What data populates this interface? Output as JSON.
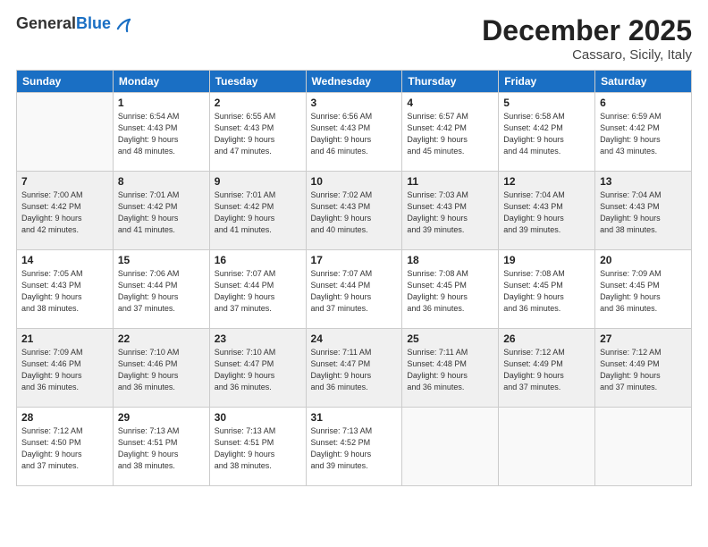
{
  "logo": {
    "general": "General",
    "blue": "Blue"
  },
  "header": {
    "month_title": "December 2025",
    "location": "Cassaro, Sicily, Italy"
  },
  "days_of_week": [
    "Sunday",
    "Monday",
    "Tuesday",
    "Wednesday",
    "Thursday",
    "Friday",
    "Saturday"
  ],
  "weeks": [
    [
      {
        "day": "",
        "info": ""
      },
      {
        "day": "1",
        "info": "Sunrise: 6:54 AM\nSunset: 4:43 PM\nDaylight: 9 hours\nand 48 minutes."
      },
      {
        "day": "2",
        "info": "Sunrise: 6:55 AM\nSunset: 4:43 PM\nDaylight: 9 hours\nand 47 minutes."
      },
      {
        "day": "3",
        "info": "Sunrise: 6:56 AM\nSunset: 4:43 PM\nDaylight: 9 hours\nand 46 minutes."
      },
      {
        "day": "4",
        "info": "Sunrise: 6:57 AM\nSunset: 4:42 PM\nDaylight: 9 hours\nand 45 minutes."
      },
      {
        "day": "5",
        "info": "Sunrise: 6:58 AM\nSunset: 4:42 PM\nDaylight: 9 hours\nand 44 minutes."
      },
      {
        "day": "6",
        "info": "Sunrise: 6:59 AM\nSunset: 4:42 PM\nDaylight: 9 hours\nand 43 minutes."
      }
    ],
    [
      {
        "day": "7",
        "info": "Sunrise: 7:00 AM\nSunset: 4:42 PM\nDaylight: 9 hours\nand 42 minutes."
      },
      {
        "day": "8",
        "info": "Sunrise: 7:01 AM\nSunset: 4:42 PM\nDaylight: 9 hours\nand 41 minutes."
      },
      {
        "day": "9",
        "info": "Sunrise: 7:01 AM\nSunset: 4:42 PM\nDaylight: 9 hours\nand 41 minutes."
      },
      {
        "day": "10",
        "info": "Sunrise: 7:02 AM\nSunset: 4:43 PM\nDaylight: 9 hours\nand 40 minutes."
      },
      {
        "day": "11",
        "info": "Sunrise: 7:03 AM\nSunset: 4:43 PM\nDaylight: 9 hours\nand 39 minutes."
      },
      {
        "day": "12",
        "info": "Sunrise: 7:04 AM\nSunset: 4:43 PM\nDaylight: 9 hours\nand 39 minutes."
      },
      {
        "day": "13",
        "info": "Sunrise: 7:04 AM\nSunset: 4:43 PM\nDaylight: 9 hours\nand 38 minutes."
      }
    ],
    [
      {
        "day": "14",
        "info": "Sunrise: 7:05 AM\nSunset: 4:43 PM\nDaylight: 9 hours\nand 38 minutes."
      },
      {
        "day": "15",
        "info": "Sunrise: 7:06 AM\nSunset: 4:44 PM\nDaylight: 9 hours\nand 37 minutes."
      },
      {
        "day": "16",
        "info": "Sunrise: 7:07 AM\nSunset: 4:44 PM\nDaylight: 9 hours\nand 37 minutes."
      },
      {
        "day": "17",
        "info": "Sunrise: 7:07 AM\nSunset: 4:44 PM\nDaylight: 9 hours\nand 37 minutes."
      },
      {
        "day": "18",
        "info": "Sunrise: 7:08 AM\nSunset: 4:45 PM\nDaylight: 9 hours\nand 36 minutes."
      },
      {
        "day": "19",
        "info": "Sunrise: 7:08 AM\nSunset: 4:45 PM\nDaylight: 9 hours\nand 36 minutes."
      },
      {
        "day": "20",
        "info": "Sunrise: 7:09 AM\nSunset: 4:45 PM\nDaylight: 9 hours\nand 36 minutes."
      }
    ],
    [
      {
        "day": "21",
        "info": "Sunrise: 7:09 AM\nSunset: 4:46 PM\nDaylight: 9 hours\nand 36 minutes."
      },
      {
        "day": "22",
        "info": "Sunrise: 7:10 AM\nSunset: 4:46 PM\nDaylight: 9 hours\nand 36 minutes."
      },
      {
        "day": "23",
        "info": "Sunrise: 7:10 AM\nSunset: 4:47 PM\nDaylight: 9 hours\nand 36 minutes."
      },
      {
        "day": "24",
        "info": "Sunrise: 7:11 AM\nSunset: 4:47 PM\nDaylight: 9 hours\nand 36 minutes."
      },
      {
        "day": "25",
        "info": "Sunrise: 7:11 AM\nSunset: 4:48 PM\nDaylight: 9 hours\nand 36 minutes."
      },
      {
        "day": "26",
        "info": "Sunrise: 7:12 AM\nSunset: 4:49 PM\nDaylight: 9 hours\nand 37 minutes."
      },
      {
        "day": "27",
        "info": "Sunrise: 7:12 AM\nSunset: 4:49 PM\nDaylight: 9 hours\nand 37 minutes."
      }
    ],
    [
      {
        "day": "28",
        "info": "Sunrise: 7:12 AM\nSunset: 4:50 PM\nDaylight: 9 hours\nand 37 minutes."
      },
      {
        "day": "29",
        "info": "Sunrise: 7:13 AM\nSunset: 4:51 PM\nDaylight: 9 hours\nand 38 minutes."
      },
      {
        "day": "30",
        "info": "Sunrise: 7:13 AM\nSunset: 4:51 PM\nDaylight: 9 hours\nand 38 minutes."
      },
      {
        "day": "31",
        "info": "Sunrise: 7:13 AM\nSunset: 4:52 PM\nDaylight: 9 hours\nand 39 minutes."
      },
      {
        "day": "",
        "info": ""
      },
      {
        "day": "",
        "info": ""
      },
      {
        "day": "",
        "info": ""
      }
    ]
  ]
}
